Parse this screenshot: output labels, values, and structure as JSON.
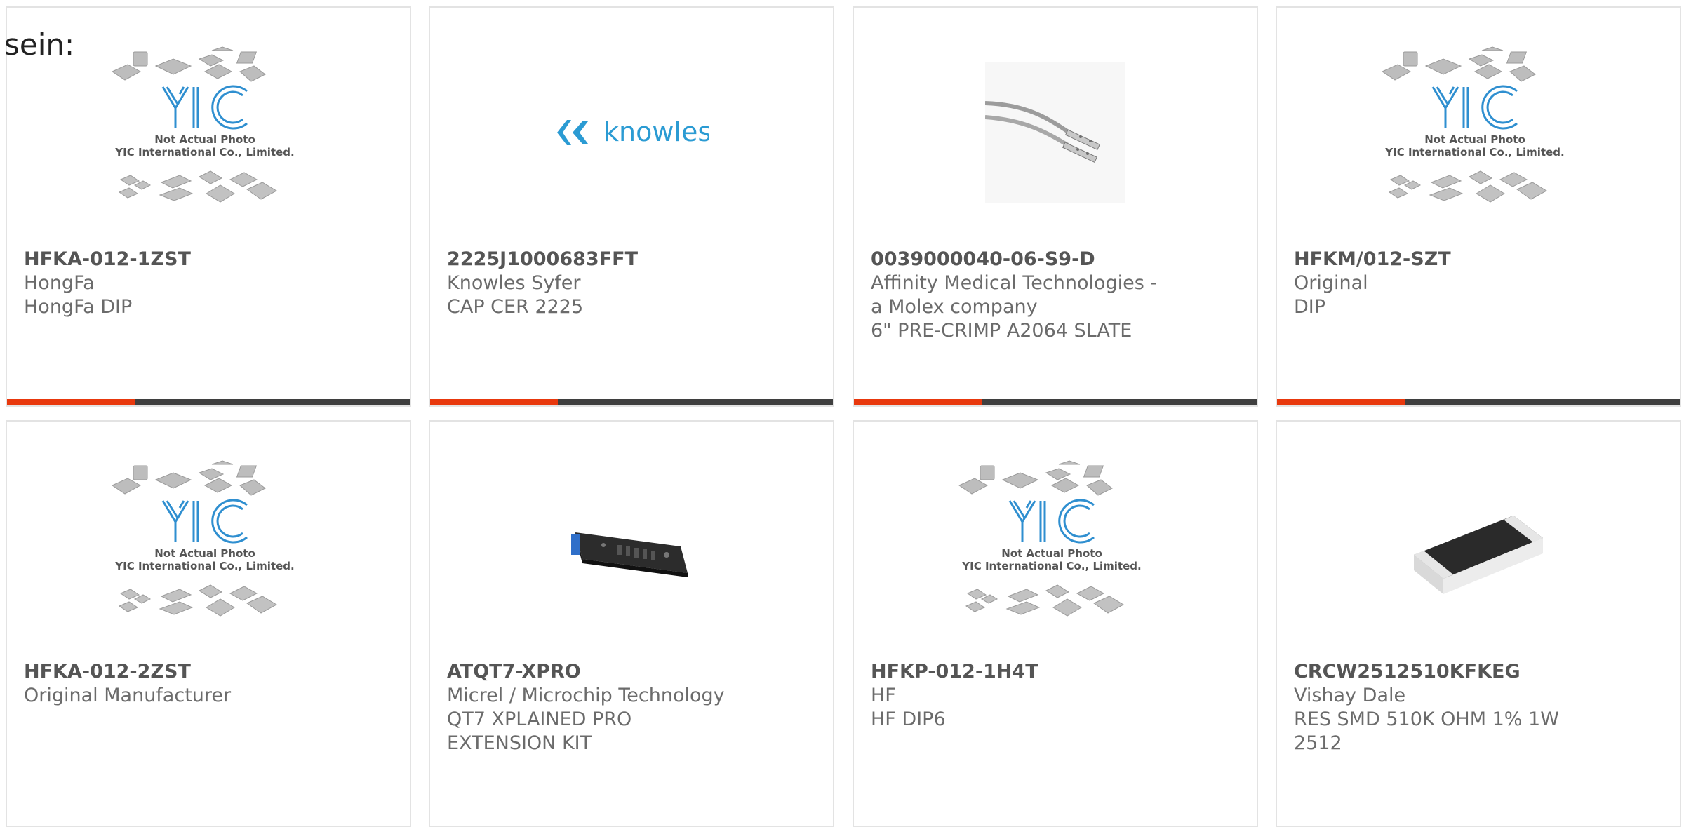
{
  "intro_text": "sein:",
  "colors": {
    "accent": "#e8380d",
    "bar_dark": "#3f3f3f",
    "knowles_blue": "#2b9bd3",
    "yic_blue": "#2f8fd0"
  },
  "placeholder": {
    "line1": "Not Actual Photo",
    "line2": "YIC International Co., Limited."
  },
  "knowles_logo_text": "knowles",
  "products": [
    {
      "part": "HFKA-012-1ZST",
      "manufacturer": "HongFa",
      "description": "HongFa DIP",
      "image": "yic-placeholder"
    },
    {
      "part": "2225J1000683FFT",
      "manufacturer": "Knowles Syfer",
      "description": "CAP CER 2225",
      "image": "knowles-logo"
    },
    {
      "part": "0039000040-06-S9-D",
      "manufacturer": "Affinity Medical Technologies - a Molex company",
      "description": "6\" PRE-CRIMP A2064 SLATE",
      "image": "crimp-wire-photo"
    },
    {
      "part": "HFKM/012-SZT",
      "manufacturer": "Original",
      "description": "DIP",
      "image": "yic-placeholder"
    },
    {
      "part": "HFKA-012-2ZST",
      "manufacturer": "Original Manufacturer",
      "description": "",
      "image": "yic-placeholder"
    },
    {
      "part": "ATQT7-XPRO",
      "manufacturer": "Micrel / Microchip Technology",
      "description": "QT7 XPLAINED PRO EXTENSION KIT",
      "image": "dev-board-photo"
    },
    {
      "part": "HFKP-012-1H4T",
      "manufacturer": "HF",
      "description": "HF DIP6",
      "image": "yic-placeholder"
    },
    {
      "part": "CRCW2512510KFKEG",
      "manufacturer": "Vishay Dale",
      "description": "RES SMD 510K OHM 1% 1W 2512",
      "image": "smd-resistor-photo"
    }
  ]
}
